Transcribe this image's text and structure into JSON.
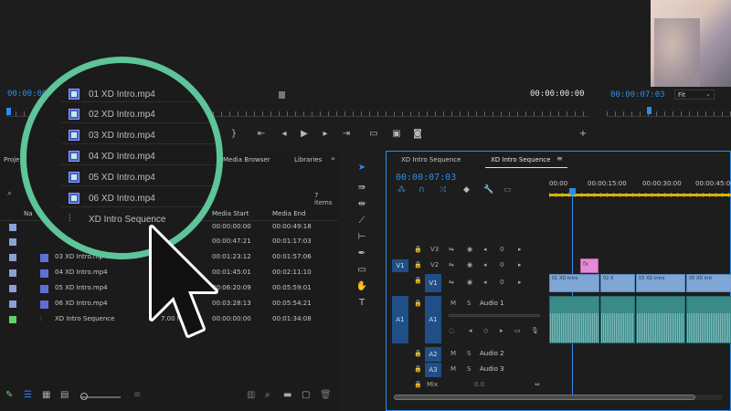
{
  "source_monitor": {
    "timecode_left": "00:00:00",
    "timecode_right": "00:00:00:00"
  },
  "program_monitor": {
    "timecode": "00:00:07:03",
    "fit": "Fit",
    "fit_arrow": "chevron-down-icon"
  },
  "project": {
    "tab_label": "Proje",
    "tabs": [
      "Media Browser",
      "Libraries"
    ],
    "items_count": "7 items",
    "col_name": "Na",
    "col_fps": "e",
    "col_media_start": "Media Start",
    "col_media_end": "Media End",
    "rows": [
      {
        "name": "",
        "fps": "",
        "start": "00:00:00:00",
        "end": "00:00:49:18",
        "color": "#8aa0d6"
      },
      {
        "name": "",
        "fps": "",
        "start": "00:00:47:21",
        "end": "00:01:17:03",
        "color": "#8aa0d6"
      },
      {
        "name": "03 XD Intro.mp4",
        "fps": "",
        "start": "00:01:23:12",
        "end": "00:01:57:06",
        "color": "#8aa0d6"
      },
      {
        "name": "04 XD Intro.mp4",
        "fps": "",
        "start": "00:01:45:01",
        "end": "00:02:11:10",
        "color": "#8aa0d6"
      },
      {
        "name": "05 XD Intro.mp4",
        "fps": "",
        "start": "00:06:20:09",
        "end": "00:05:59:01",
        "color": "#8aa0d6"
      },
      {
        "name": "06 XD Intro.mp4",
        "fps": "",
        "start": "00:03:28:13",
        "end": "00:05:54:21",
        "color": "#8aa0d6"
      },
      {
        "name": "XD Intro Sequence",
        "fps": "7.00 fps",
        "start": "00:00:00:00",
        "end": "00:01:34:08",
        "color": "#5fd26a"
      }
    ]
  },
  "loupe": {
    "items": [
      {
        "label": "01 XD Intro.mp4",
        "icon": "video-file-icon"
      },
      {
        "label": "02 XD Intro.mp4",
        "icon": "video-file-icon"
      },
      {
        "label": "03 XD Intro.mp4",
        "icon": "video-file-icon"
      },
      {
        "label": "04 XD Intro.mp4",
        "icon": "video-file-icon"
      },
      {
        "label": "05 XD Intro.mp4",
        "icon": "video-file-icon"
      },
      {
        "label": "06 XD Intro.mp4",
        "icon": "video-file-icon"
      },
      {
        "label": "XD Intro Sequence",
        "icon": "sequence-icon"
      }
    ],
    "ring_color": "#5ec49a"
  },
  "timeline": {
    "tabs": [
      "XD Intro Sequence",
      "XD Intro Sequence"
    ],
    "menu_icon": "hamburger-icon",
    "timecode": "00:00:07:03",
    "ruler": [
      "00:00",
      "00:00:15:00",
      "00:00:30:00",
      "00:00:45:00"
    ],
    "video_tracks": [
      "V3",
      "V2",
      "V1"
    ],
    "audio_tracks": [
      {
        "id": "A1",
        "name": "Audio 1",
        "m": "M",
        "s": "S"
      },
      {
        "id": "A2",
        "name": "Audio 2",
        "m": "M",
        "s": "S"
      },
      {
        "id": "A3",
        "name": "Audio 3",
        "m": "M",
        "s": "S"
      }
    ],
    "src_v": "V1",
    "src_a": "A1",
    "mix_label": "Mix",
    "mix_value": "0.0",
    "lock_vals": [
      "0",
      "0",
      "0"
    ],
    "clips": [
      "01 XD Intro",
      "02 X",
      "03 XD Intro",
      "05 XD Intr"
    ],
    "fx_label": "fx"
  },
  "colors": {
    "accent": "#2d8ceb",
    "ring": "#5ec49a",
    "video_clip": "#7fa7d6",
    "audio_clip": "#3b8a8a"
  }
}
